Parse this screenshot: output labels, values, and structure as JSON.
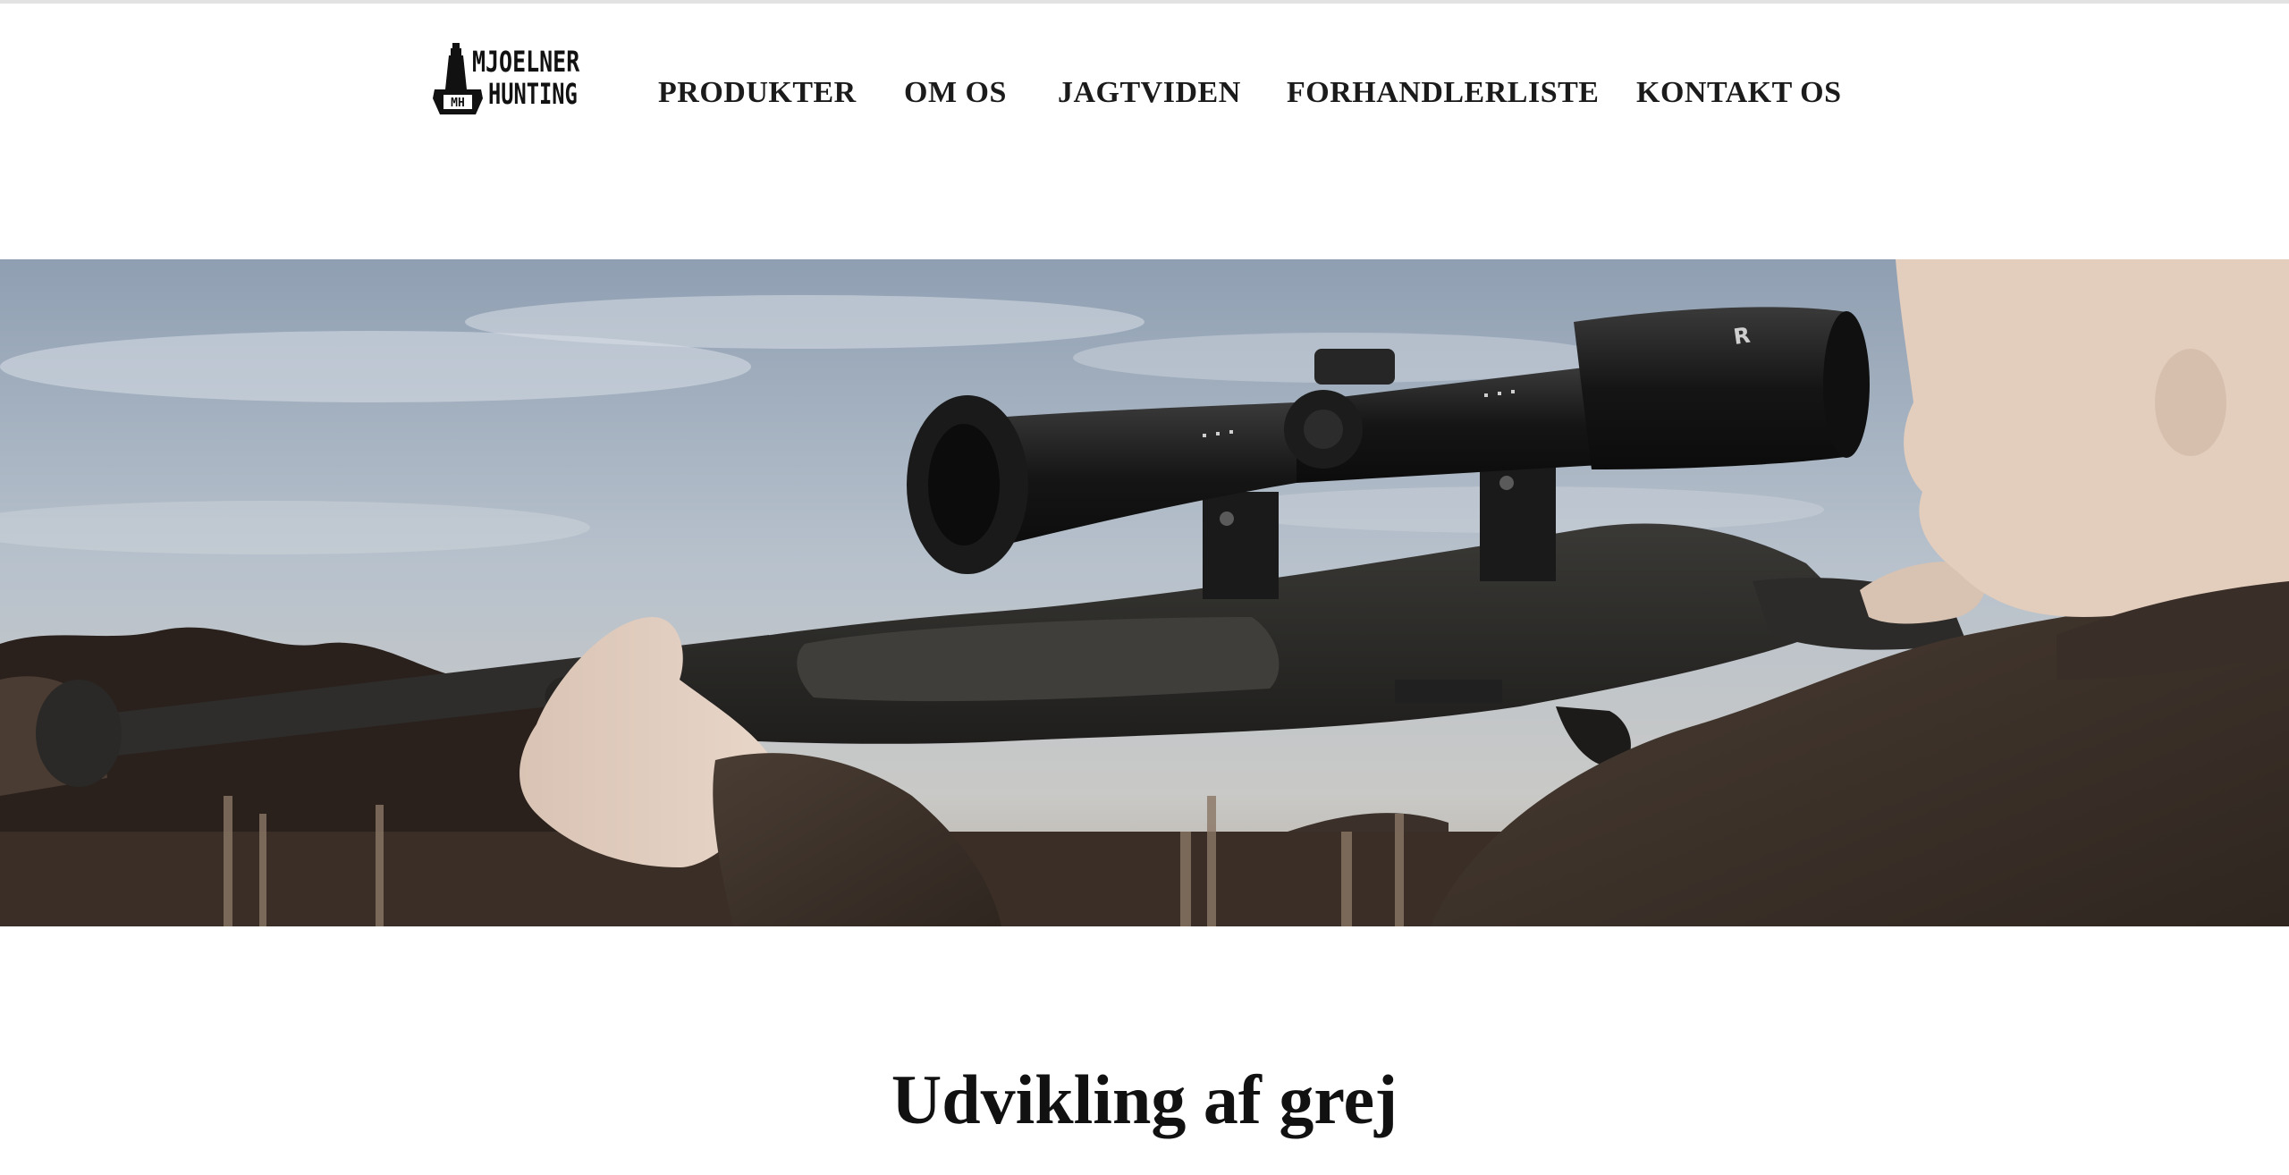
{
  "brand": {
    "logo_line1": "MJOELNER",
    "logo_line2": "HUNTING",
    "logo_monogram": "MH"
  },
  "nav": {
    "items": [
      {
        "label": "PRODUKTER"
      },
      {
        "label": "OM OS"
      },
      {
        "label": "JAGTVIDEN"
      },
      {
        "label": "FORHANDLERLISTE"
      },
      {
        "label": "KONTAKT OS"
      }
    ]
  },
  "hero": {
    "scope_brand_mark": "R"
  },
  "content": {
    "section_title": "Udvikling af grej"
  },
  "colors": {
    "text": "#1b1b1b",
    "background": "#ffffff",
    "sky": "#a9b6c4",
    "rifle": "#2b2a28"
  }
}
